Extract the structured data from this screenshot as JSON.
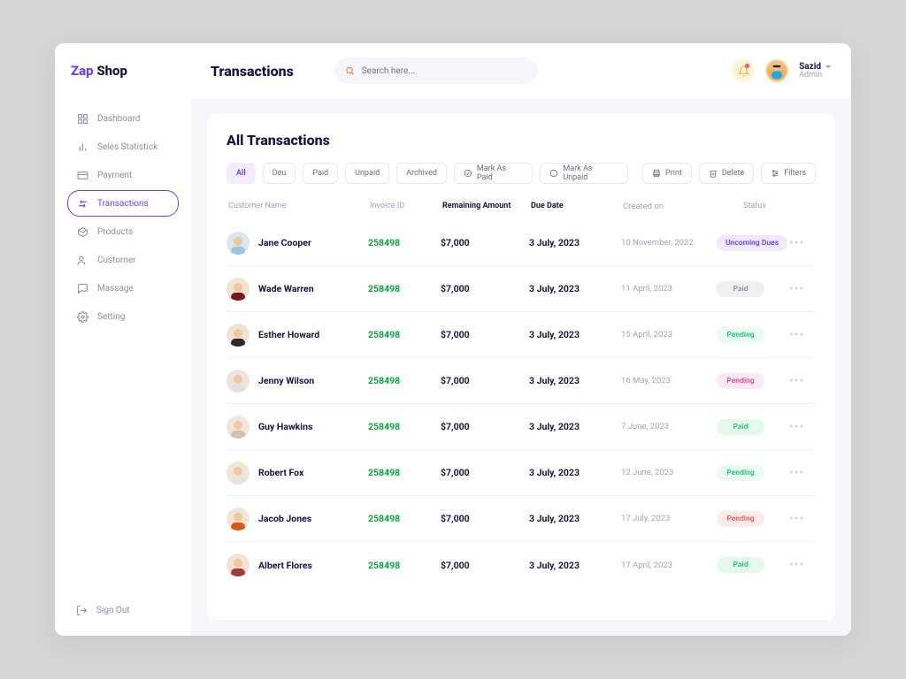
{
  "brand": {
    "part1": "Zap ",
    "part2": "Shop"
  },
  "topbar": {
    "title": "Transactions"
  },
  "search": {
    "placeholder": "Search here..."
  },
  "user": {
    "name": "Sazid",
    "role": "Admin"
  },
  "sidebar": {
    "items": [
      {
        "label": "Dashboard"
      },
      {
        "label": "Seles Statistick"
      },
      {
        "label": "Payment"
      },
      {
        "label": "Transactions"
      },
      {
        "label": "Products"
      },
      {
        "label": "Customer"
      },
      {
        "label": "Massage"
      },
      {
        "label": "Setting"
      }
    ],
    "signout": "Sign Out"
  },
  "card": {
    "title": "All Transactions"
  },
  "filters": {
    "all": "All",
    "deu": "Deu",
    "paid": "Paid",
    "unpaid": "Unpaid",
    "archived": "Archived",
    "mark_paid": "Mark As Paid",
    "mark_unpaid": "Mark As Unpaid",
    "print": "Print",
    "delete": "Delete",
    "filters_btn": "Filters"
  },
  "columns": {
    "name": "Customer Name",
    "invoice": "Invoice ID",
    "remaining": "Remaining Amount",
    "due": "Due Date",
    "created": "Created on",
    "status": "Status"
  },
  "rows": [
    {
      "name": "Jane Cooper",
      "invoice": "258498",
      "remaining": "$7,000",
      "due": "3 July, 2023",
      "created": "10 November, 2022",
      "status": "Uncoming Dues",
      "variant": "upcoming",
      "bg": "#dbe7ef",
      "shirt": "#9cc4da"
    },
    {
      "name": "Wade Warren",
      "invoice": "258498",
      "remaining": "$7,000",
      "due": "3 July, 2023",
      "created": "11 April, 2023",
      "status": "Paid",
      "variant": "paid",
      "bg": "#f2e2d4",
      "shirt": "#7a1616"
    },
    {
      "name": "Esther Howard",
      "invoice": "258498",
      "remaining": "$7,000",
      "due": "3 July, 2023",
      "created": "15 April, 2023",
      "status": "Pending",
      "variant": "pending-g",
      "bg": "#efe3d5",
      "shirt": "#2b2b2b"
    },
    {
      "name": "Jenny Wilson",
      "invoice": "258498",
      "remaining": "$7,000",
      "due": "3 July, 2023",
      "created": "16 May, 2023",
      "status": "Pending",
      "variant": "pending-p",
      "bg": "#ece4da",
      "shirt": "#dfe1e0"
    },
    {
      "name": "Guy Hawkins",
      "invoice": "258498",
      "remaining": "$7,000",
      "due": "3 July, 2023",
      "created": "7 June, 2023",
      "status": "Paid",
      "variant": "paid-g",
      "bg": "#efe7dc",
      "shirt": "#cfc2b1"
    },
    {
      "name": "Robert Fox",
      "invoice": "258498",
      "remaining": "$7,000",
      "due": "3 July, 2023",
      "created": "12 June, 2023",
      "status": "Pending",
      "variant": "pending-g",
      "bg": "#f0e6d6",
      "shirt": "#e8e3db"
    },
    {
      "name": "Jacob Jones",
      "invoice": "258498",
      "remaining": "$7,000",
      "due": "3 July, 2023",
      "created": "17  July, 2023",
      "status": "Pending",
      "variant": "pending-r",
      "bg": "#f2e4d6",
      "shirt": "#d65a1a"
    },
    {
      "name": "Albert Flores",
      "invoice": "258498",
      "remaining": "$7,000",
      "due": "3 July, 2023",
      "created": "17 April, 2023",
      "status": "Paid",
      "variant": "paid-g",
      "bg": "#ede3d7",
      "shirt": "#a33a3a"
    }
  ]
}
